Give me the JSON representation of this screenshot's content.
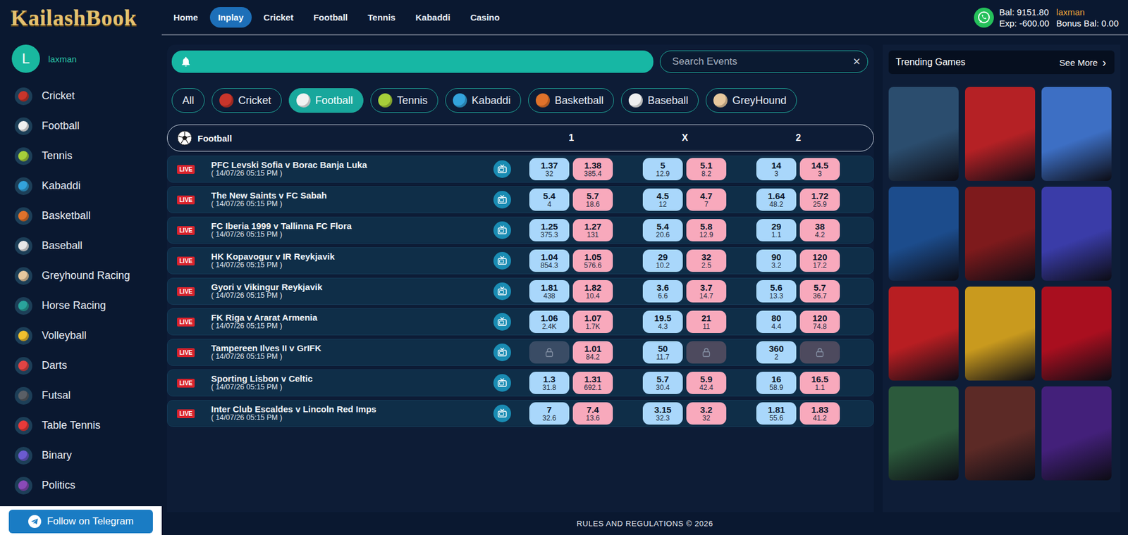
{
  "header": {
    "logo": "KailashBook",
    "nav": [
      {
        "label": "Home",
        "selected": false
      },
      {
        "label": "Inplay",
        "selected": true
      },
      {
        "label": "Cricket",
        "selected": false
      },
      {
        "label": "Football",
        "selected": false
      },
      {
        "label": "Tennis",
        "selected": false
      },
      {
        "label": "Kabaddi",
        "selected": false
      },
      {
        "label": "Casino",
        "selected": false
      }
    ],
    "account": {
      "balance": "Bal: 9151.80",
      "exposure": "Exp: -600.00",
      "username": "laxman",
      "bonus": "Bonus Bal: 0.00"
    }
  },
  "sidebar": {
    "user": {
      "initial": "L",
      "name": "laxman"
    },
    "items": [
      {
        "label": "Cricket",
        "color": "#c8352b"
      },
      {
        "label": "Football",
        "color": "#f0f0f0"
      },
      {
        "label": "Tennis",
        "color": "#a6cf3a"
      },
      {
        "label": "Kabaddi",
        "color": "#33a3dc"
      },
      {
        "label": "Basketball",
        "color": "#e0722b"
      },
      {
        "label": "Baseball",
        "color": "#e8e8e8"
      },
      {
        "label": "Greyhound Racing",
        "color": "#e7c89e"
      },
      {
        "label": "Horse Racing",
        "color": "#2aa39c"
      },
      {
        "label": "Volleyball",
        "color": "#f0c02e"
      },
      {
        "label": "Darts",
        "color": "#e04444"
      },
      {
        "label": "Futsal",
        "color": "#5a5f66"
      },
      {
        "label": "Table Tennis",
        "color": "#e83a3a"
      },
      {
        "label": "Binary",
        "color": "#6b5bd0"
      },
      {
        "label": "Politics",
        "color": "#8a4ab8"
      }
    ],
    "telegram": "Follow on Telegram"
  },
  "search": {
    "placeholder": "Search Events",
    "clear": "×"
  },
  "filters": [
    {
      "label": "All",
      "selected": false,
      "kind": "text",
      "color": "#000000"
    },
    {
      "label": "Cricket",
      "selected": false,
      "kind": "icon",
      "color": "#c8352b"
    },
    {
      "label": "Football",
      "selected": true,
      "kind": "icon",
      "color": "#f2f2f2"
    },
    {
      "label": "Tennis",
      "selected": false,
      "kind": "icon",
      "color": "#a6cf3a"
    },
    {
      "label": "Kabaddi",
      "selected": false,
      "kind": "icon",
      "color": "#33a3dc"
    },
    {
      "label": "Basketball",
      "selected": false,
      "kind": "icon",
      "color": "#e0722b"
    },
    {
      "label": "Baseball",
      "selected": false,
      "kind": "icon",
      "color": "#efefef"
    },
    {
      "label": "GreyHound",
      "selected": false,
      "kind": "icon",
      "color": "#e7c89e"
    }
  ],
  "table": {
    "title": "Football",
    "columns": [
      "1",
      "X",
      "2"
    ],
    "rows": [
      {
        "badge": "LIVE",
        "name": "PFC Levski Sofia v Borac Banja Luka",
        "date": "( 14/07/26 05:15 PM )",
        "odds": [
          [
            {
              "kind": "back",
              "locked": false,
              "price": "1.37",
              "size": "32"
            },
            {
              "kind": "lay",
              "locked": false,
              "price": "1.38",
              "size": "385.4"
            }
          ],
          [
            {
              "kind": "back",
              "locked": false,
              "price": "5",
              "size": "12.9"
            },
            {
              "kind": "lay",
              "locked": false,
              "price": "5.1",
              "size": "8.2"
            }
          ],
          [
            {
              "kind": "back",
              "locked": false,
              "price": "14",
              "size": "3"
            },
            {
              "kind": "lay",
              "locked": false,
              "price": "14.5",
              "size": "3"
            }
          ]
        ]
      },
      {
        "badge": "LIVE",
        "name": "The New Saints v FC Sabah",
        "date": "( 14/07/26 05:15 PM )",
        "odds": [
          [
            {
              "kind": "back",
              "locked": false,
              "price": "5.4",
              "size": "4"
            },
            {
              "kind": "lay",
              "locked": false,
              "price": "5.7",
              "size": "18.6"
            }
          ],
          [
            {
              "kind": "back",
              "locked": false,
              "price": "4.5",
              "size": "12"
            },
            {
              "kind": "lay",
              "locked": false,
              "price": "4.7",
              "size": "7"
            }
          ],
          [
            {
              "kind": "back",
              "locked": false,
              "price": "1.64",
              "size": "48.2"
            },
            {
              "kind": "lay",
              "locked": false,
              "price": "1.72",
              "size": "25.9"
            }
          ]
        ]
      },
      {
        "badge": "LIVE",
        "name": "FC Iberia 1999 v Tallinna FC Flora",
        "date": "( 14/07/26 05:15 PM )",
        "odds": [
          [
            {
              "kind": "back",
              "locked": false,
              "price": "1.25",
              "size": "375.3"
            },
            {
              "kind": "lay",
              "locked": false,
              "price": "1.27",
              "size": "131"
            }
          ],
          [
            {
              "kind": "back",
              "locked": false,
              "price": "5.4",
              "size": "20.6"
            },
            {
              "kind": "lay",
              "locked": false,
              "price": "5.8",
              "size": "12.9"
            }
          ],
          [
            {
              "kind": "back",
              "locked": false,
              "price": "29",
              "size": "1.1"
            },
            {
              "kind": "lay",
              "locked": false,
              "price": "38",
              "size": "4.2"
            }
          ]
        ]
      },
      {
        "badge": "LIVE",
        "name": "HK Kopavogur v IR Reykjavik",
        "date": "( 14/07/26 05:15 PM )",
        "odds": [
          [
            {
              "kind": "back",
              "locked": false,
              "price": "1.04",
              "size": "854.3"
            },
            {
              "kind": "lay",
              "locked": false,
              "price": "1.05",
              "size": "576.6"
            }
          ],
          [
            {
              "kind": "back",
              "locked": false,
              "price": "29",
              "size": "10.2"
            },
            {
              "kind": "lay",
              "locked": false,
              "price": "32",
              "size": "2.5"
            }
          ],
          [
            {
              "kind": "back",
              "locked": false,
              "price": "90",
              "size": "3.2"
            },
            {
              "kind": "lay",
              "locked": false,
              "price": "120",
              "size": "17.2"
            }
          ]
        ]
      },
      {
        "badge": "LIVE",
        "name": "Gyori v Vikingur Reykjavik",
        "date": "( 14/07/26 05:15 PM )",
        "odds": [
          [
            {
              "kind": "back",
              "locked": false,
              "price": "1.81",
              "size": "438"
            },
            {
              "kind": "lay",
              "locked": false,
              "price": "1.82",
              "size": "10.4"
            }
          ],
          [
            {
              "kind": "back",
              "locked": false,
              "price": "3.6",
              "size": "6.6"
            },
            {
              "kind": "lay",
              "locked": false,
              "price": "3.7",
              "size": "14.7"
            }
          ],
          [
            {
              "kind": "back",
              "locked": false,
              "price": "5.6",
              "size": "13.3"
            },
            {
              "kind": "lay",
              "locked": false,
              "price": "5.7",
              "size": "36.7"
            }
          ]
        ]
      },
      {
        "badge": "LIVE",
        "name": "FK Riga v Ararat Armenia",
        "date": "( 14/07/26 05:15 PM )",
        "odds": [
          [
            {
              "kind": "back",
              "locked": false,
              "price": "1.06",
              "size": "2.4K"
            },
            {
              "kind": "lay",
              "locked": false,
              "price": "1.07",
              "size": "1.7K"
            }
          ],
          [
            {
              "kind": "back",
              "locked": false,
              "price": "19.5",
              "size": "4.3"
            },
            {
              "kind": "lay",
              "locked": false,
              "price": "21",
              "size": "11"
            }
          ],
          [
            {
              "kind": "back",
              "locked": false,
              "price": "80",
              "size": "4.4"
            },
            {
              "kind": "lay",
              "locked": false,
              "price": "120",
              "size": "74.8"
            }
          ]
        ]
      },
      {
        "badge": "LIVE",
        "name": "Tampereen Ilves II v GrIFK",
        "date": "( 14/07/26 05:15 PM )",
        "odds": [
          [
            {
              "kind": "back",
              "locked": true
            },
            {
              "kind": "lay",
              "locked": false,
              "price": "1.01",
              "size": "84.2"
            }
          ],
          [
            {
              "kind": "back",
              "locked": false,
              "price": "50",
              "size": "11.7"
            },
            {
              "kind": "lay",
              "locked": true
            }
          ],
          [
            {
              "kind": "back",
              "locked": false,
              "price": "360",
              "size": "2"
            },
            {
              "kind": "lay",
              "locked": true
            }
          ]
        ]
      },
      {
        "badge": "LIVE",
        "name": "Sporting Lisbon v Celtic",
        "date": "( 14/07/26 05:15 PM )",
        "odds": [
          [
            {
              "kind": "back",
              "locked": false,
              "price": "1.3",
              "size": "31.8"
            },
            {
              "kind": "lay",
              "locked": false,
              "price": "1.31",
              "size": "692.1"
            }
          ],
          [
            {
              "kind": "back",
              "locked": false,
              "price": "5.7",
              "size": "30.4"
            },
            {
              "kind": "lay",
              "locked": false,
              "price": "5.9",
              "size": "42.4"
            }
          ],
          [
            {
              "kind": "back",
              "locked": false,
              "price": "16",
              "size": "58.9"
            },
            {
              "kind": "lay",
              "locked": false,
              "price": "16.5",
              "size": "1.1"
            }
          ]
        ]
      },
      {
        "badge": "LIVE",
        "name": "Inter Club Escaldes v Lincoln Red Imps",
        "date": "( 14/07/26 05:15 PM )",
        "odds": [
          [
            {
              "kind": "back",
              "locked": false,
              "price": "7",
              "size": "32.6"
            },
            {
              "kind": "lay",
              "locked": false,
              "price": "7.4",
              "size": "13.6"
            }
          ],
          [
            {
              "kind": "back",
              "locked": false,
              "price": "3.15",
              "size": "32.3"
            },
            {
              "kind": "lay",
              "locked": false,
              "price": "3.2",
              "size": "32"
            }
          ],
          [
            {
              "kind": "back",
              "locked": false,
              "price": "1.81",
              "size": "55.6"
            },
            {
              "kind": "lay",
              "locked": false,
              "price": "1.83",
              "size": "41.2"
            }
          ]
        ]
      }
    ]
  },
  "trending": {
    "title": "Trending Games",
    "more": "See More",
    "more_icon": "›",
    "tiles": [
      {
        "color": "#2b4d6e"
      },
      {
        "color": "#b52125"
      },
      {
        "color": "#3d6fc4"
      },
      {
        "color": "#1c4c8c"
      },
      {
        "color": "#7e1a1c"
      },
      {
        "color": "#3a3ca8"
      },
      {
        "color": "#b81e22"
      },
      {
        "color": "#c99a1e"
      },
      {
        "color": "#a90f1f"
      },
      {
        "color": "#2c5a3c"
      },
      {
        "color": "#5c2a26"
      },
      {
        "color": "#43207a"
      }
    ]
  },
  "footer": "RULES AND REGULATIONS © 2026"
}
